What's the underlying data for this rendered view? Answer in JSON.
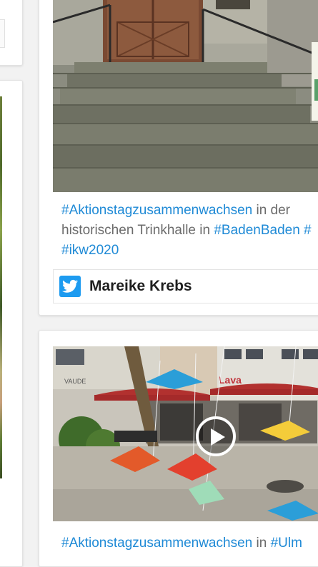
{
  "post_a": {
    "caption": {
      "tag1": "#Aktionstagzusammenwachsen",
      "text1": " in der",
      "text2": "historischen Trinkhalle in ",
      "tag2": "#BadenBaden",
      "text3": " #",
      "tag3": "#ikw2020"
    },
    "source": {
      "icon": "twitter-icon",
      "author": "Mareike Krebs"
    }
  },
  "post_b": {
    "caption": {
      "tag1": "#Aktionstagzusammenwachsen",
      "text1": " in ",
      "tag2": "#Ulm"
    },
    "video_icon": "play-icon"
  },
  "colors": {
    "hashtag": "#1f8ad6",
    "twitter": "#1d9bf0",
    "caption_text": "#6b6b6b"
  }
}
